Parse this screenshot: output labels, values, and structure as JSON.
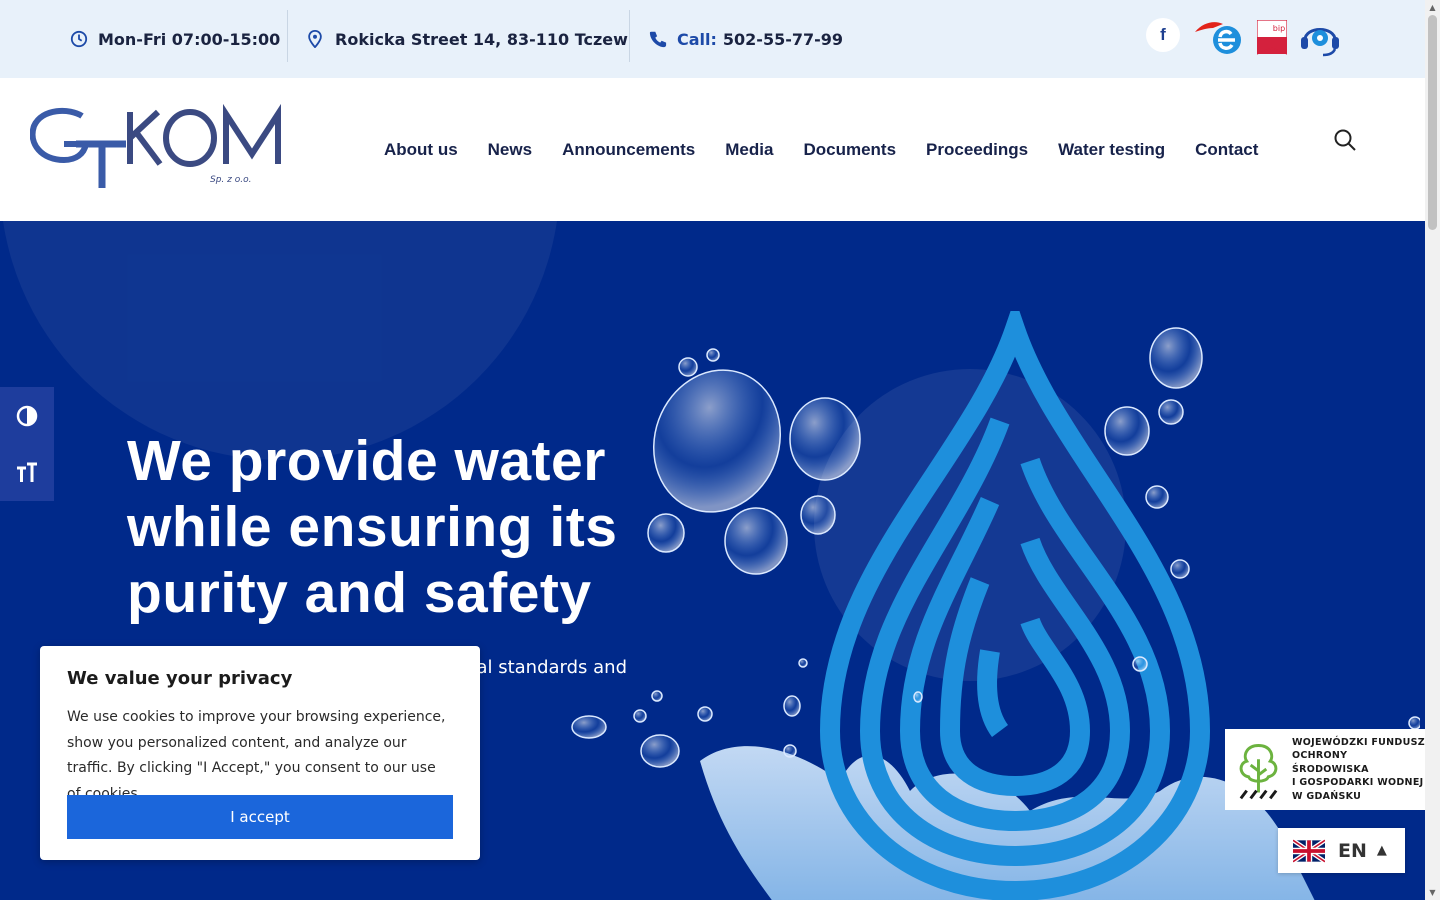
{
  "topbar": {
    "hours": "Mon-Fri 07:00-15:00",
    "address": "Rokicka Street 14, 83-110 Tczew",
    "call_label": "Call:",
    "phone": "502-55-77-99",
    "social": [
      {
        "name": "facebook-icon",
        "glyph": "f"
      },
      {
        "name": "epuap-icon"
      },
      {
        "name": "bip-icon",
        "label": "bip"
      },
      {
        "name": "customer-service-icon"
      }
    ]
  },
  "header": {
    "logo_text": "GTKOM",
    "logo_sub": "Sp. z o.o.",
    "nav": [
      "About us",
      "News",
      "Announcements",
      "Media",
      "Documents",
      "Proceedings",
      "Water testing",
      "Contact"
    ]
  },
  "hero": {
    "headline": "We provide water while ensuring its purity and safety",
    "subtext": "al standards and"
  },
  "accessibility": {
    "contrast_icon": "contrast-icon",
    "font_icon": "font-size-icon",
    "font_glyph": "тT"
  },
  "cookie": {
    "title": "We value your privacy",
    "body": "We use cookies to improve your browsing experience, show you personalized content, and analyze our traffic. By clicking \"I Accept,\" you consent to our use ",
    "link": "of cookies.",
    "accept": "I accept"
  },
  "fund": {
    "lines": [
      "WOJEWÓDZKI FUNDUSZ",
      "OCHRONY ŚRODOWISKA",
      "I GOSPODARKI WODNEJ",
      "W GDAŃSKU"
    ]
  },
  "language": {
    "code": "EN"
  },
  "colors": {
    "hero_bg": "#00298a",
    "accent": "#1b66db",
    "drop_blue": "#1e8fdc"
  }
}
